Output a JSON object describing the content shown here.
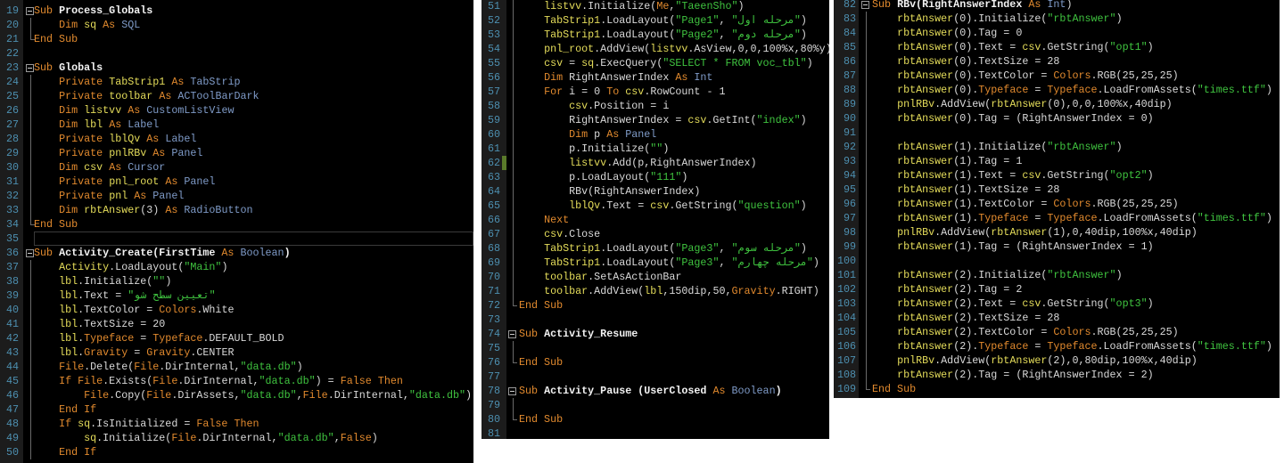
{
  "panels": [
    {
      "current_line": 35,
      "modified_lines": [],
      "lines": [
        [
          19,
          "k:Sub| |n:Process_Globals"
        ],
        [
          20,
          "    |k:Dim| |v:sq| |k:As| |t:SQL"
        ],
        [
          21,
          "k:End Sub"
        ],
        [
          22,
          ""
        ],
        [
          23,
          "k:Sub| |n:Globals"
        ],
        [
          24,
          "    |k:Private| |v:TabStrip1| |k:As| |t:TabStrip"
        ],
        [
          25,
          "    |k:Private| |v:toolbar| |k:As| |t:ACToolBarDark"
        ],
        [
          26,
          "    |k:Dim| |v:listvv| |k:As| |t:CustomListView"
        ],
        [
          27,
          "    |k:Dim| |v:lbl| |k:As| |t:Label"
        ],
        [
          28,
          "    |k:Private| |v:lblQv| |k:As| |t:Label"
        ],
        [
          29,
          "    |k:Private| |v:pnlRBv| |k:As| |t:Panel"
        ],
        [
          30,
          "    |k:Dim| |v:csv| |k:As| |t:Cursor"
        ],
        [
          31,
          "    |k:Private| |v:pnl_root| |k:As| |t:Panel"
        ],
        [
          32,
          "    |k:Private| |v:pnl| |k:As| |t:Panel"
        ],
        [
          33,
          "    |k:Dim| |v:rbtAnswer|(3) |k:As| |t:RadioButton"
        ],
        [
          34,
          "k:End Sub"
        ],
        [
          35,
          ""
        ],
        [
          36,
          "k:Sub| |n:Activity_Create(FirstTime |k:As| |t:Boolean|n:)"
        ],
        [
          37,
          "    |v:Activity|.LoadLayout(|s:\"Main\"|)"
        ],
        [
          38,
          "    |v:lbl|.Initialize(|s:\"\"|)"
        ],
        [
          39,
          "    |v:lbl|.Text = |a:\"تعيين سطح شو\""
        ],
        [
          40,
          "    |v:lbl|.TextColor = |o:Colors|.White"
        ],
        [
          41,
          "    |v:lbl|.TextSize = 20"
        ],
        [
          42,
          "    |v:lbl|.|o:Typeface| = |o:Typeface|.DEFAULT_BOLD"
        ],
        [
          43,
          "    |v:lbl|.|o:Gravity| = |o:Gravity|.CENTER"
        ],
        [
          44,
          "    |o:File|.Delete(|o:File|.DirInternal,|s:\"data.db\"|)"
        ],
        [
          45,
          "    |k:If| |o:File|.Exists(|o:File|.DirInternal,|s:\"data.db\"|) = |k:False Then"
        ],
        [
          46,
          "        |o:File|.Copy(|o:File|.DirAssets,|s:\"data.db\"|,|o:File|.DirInternal,|s:\"data.db\"|)"
        ],
        [
          47,
          "    |k:End If"
        ],
        [
          48,
          "    |k:If| |v:sq|.IsInitialized = |k:False Then"
        ],
        [
          49,
          "        |v:sq|.Initialize(|o:File|.DirInternal,|s:\"data.db\"|,|k:False|)"
        ],
        [
          50,
          "    |k:End If"
        ]
      ]
    },
    {
      "current_line": null,
      "modified_lines": [
        62
      ],
      "lines": [
        [
          51,
          "    |v:listvv|.Initialize(|o:Me|,|s:\"TaeenSho\"|)"
        ],
        [
          52,
          "    |v:TabStrip1|.LoadLayout(|s:\"Page1\"|, |a:\"مرحله اول\"|)"
        ],
        [
          53,
          "    |v:TabStrip1|.LoadLayout(|s:\"Page2\"|, |a:\"مرحله دوم\"|)"
        ],
        [
          54,
          "    |v:pnl_root|.AddView(|v:listvv|.AsView,0,0,100%x,80%y)"
        ],
        [
          55,
          "    |v:csv| = |v:sq|.ExecQuery(|s:\"SELECT * FROM voc_tbl\"|)"
        ],
        [
          56,
          "    |k:Dim| RightAnswerIndex |k:As| |t:Int"
        ],
        [
          57,
          "    |k:For| i = 0 |k:To| |v:csv|.RowCount - 1"
        ],
        [
          58,
          "        |v:csv|.Position = i"
        ],
        [
          59,
          "        RightAnswerIndex = |v:csv|.GetInt(|s:\"index\"|)"
        ],
        [
          60,
          "        |k:Dim| p |k:As| |t:Panel"
        ],
        [
          61,
          "        p.Initialize(|s:\"\"|)"
        ],
        [
          62,
          "        |v:listvv|.Add(p,RightAnswerIndex)"
        ],
        [
          63,
          "        p.LoadLayout(|s:\"111\"|)"
        ],
        [
          64,
          "        RBv(RightAnswerIndex)"
        ],
        [
          65,
          "        |v:lblQv|.Text = |v:csv|.GetString(|s:\"question\"|)"
        ],
        [
          66,
          "    |k:Next"
        ],
        [
          67,
          "    |v:csv|.Close"
        ],
        [
          68,
          "    |v:TabStrip1|.LoadLayout(|s:\"Page3\"|, |a:\"مرحله سوم\"|)"
        ],
        [
          69,
          "    |v:TabStrip1|.LoadLayout(|s:\"Page3\"|, |a:\"مرحله چهارم\"|)"
        ],
        [
          70,
          "    |v:toolbar|.SetAsActionBar"
        ],
        [
          71,
          "    |v:toolbar|.AddView(|v:lbl|,150dip,50,|o:Gravity|.RIGHT)"
        ],
        [
          72,
          "k:End Sub"
        ],
        [
          73,
          ""
        ],
        [
          74,
          "k:Sub| |n:Activity_Resume"
        ],
        [
          75,
          ""
        ],
        [
          76,
          "k:End Sub"
        ],
        [
          77,
          ""
        ],
        [
          78,
          "k:Sub| |n:Activity_Pause (UserClosed |k:As| |t:Boolean|n:)"
        ],
        [
          79,
          ""
        ],
        [
          80,
          "k:End Sub"
        ],
        [
          81,
          ""
        ]
      ]
    },
    {
      "current_line": null,
      "modified_lines": [],
      "lines": [
        [
          82,
          "k:Sub| |n:RBv(RightAnswerIndex |k:As| |t:Int|)"
        ],
        [
          83,
          "    |v:rbtAnswer|(0).Initialize(|s:\"rbtAnswer\"|)"
        ],
        [
          84,
          "    |v:rbtAnswer|(0).Tag = 0"
        ],
        [
          85,
          "    |v:rbtAnswer|(0).Text = |v:csv|.GetString(|s:\"opt1\"|)"
        ],
        [
          86,
          "    |v:rbtAnswer|(0).TextSize = 28"
        ],
        [
          87,
          "    |v:rbtAnswer|(0).TextColor = |o:Colors|.RGB(25,25,25)"
        ],
        [
          88,
          "    |v:rbtAnswer|(0).|o:Typeface| = |o:Typeface|.LoadFromAssets(|s:\"times.ttf\"|)"
        ],
        [
          89,
          "    |v:pnlRBv|.AddView(|v:rbtAnswer|(0),0,0,100%x,40dip)"
        ],
        [
          90,
          "    |v:rbtAnswer|(0).Tag = (RightAnswerIndex = 0)"
        ],
        [
          91,
          ""
        ],
        [
          92,
          "    |v:rbtAnswer|(1).Initialize(|s:\"rbtAnswer\"|)"
        ],
        [
          93,
          "    |v:rbtAnswer|(1).Tag = 1"
        ],
        [
          94,
          "    |v:rbtAnswer|(1).Text = |v:csv|.GetString(|s:\"opt2\"|)"
        ],
        [
          95,
          "    |v:rbtAnswer|(1).TextSize = 28"
        ],
        [
          96,
          "    |v:rbtAnswer|(1).TextColor = |o:Colors|.RGB(25,25,25)"
        ],
        [
          97,
          "    |v:rbtAnswer|(1).|o:Typeface| = |o:Typeface|.LoadFromAssets(|s:\"times.ttf\"|)"
        ],
        [
          98,
          "    |v:pnlRBv|.AddView(|v:rbtAnswer|(1),0,40dip,100%x,40dip)"
        ],
        [
          99,
          "    |v:rbtAnswer|(1).Tag = (RightAnswerIndex = 1)"
        ],
        [
          100,
          ""
        ],
        [
          101,
          "    |v:rbtAnswer|(2).Initialize(|s:\"rbtAnswer\"|)"
        ],
        [
          102,
          "    |v:rbtAnswer|(2).Tag = 2"
        ],
        [
          103,
          "    |v:rbtAnswer|(2).Text = |v:csv|.GetString(|s:\"opt3\"|)"
        ],
        [
          104,
          "    |v:rbtAnswer|(2).TextSize = 28"
        ],
        [
          105,
          "    |v:rbtAnswer|(2).TextColor = |o:Colors|.RGB(25,25,25)"
        ],
        [
          106,
          "    |v:rbtAnswer|(2).|o:Typeface| = |o:Typeface|.LoadFromAssets(|s:\"times.ttf\"|)"
        ],
        [
          107,
          "    |v:pnlRBv|.AddView(|v:rbtAnswer|(2),0,80dip,100%x,40dip)"
        ],
        [
          108,
          "    |v:rbtAnswer|(2).Tag = (RightAnswerIndex = 2)"
        ],
        [
          109,
          "k:End Sub"
        ]
      ]
    }
  ]
}
